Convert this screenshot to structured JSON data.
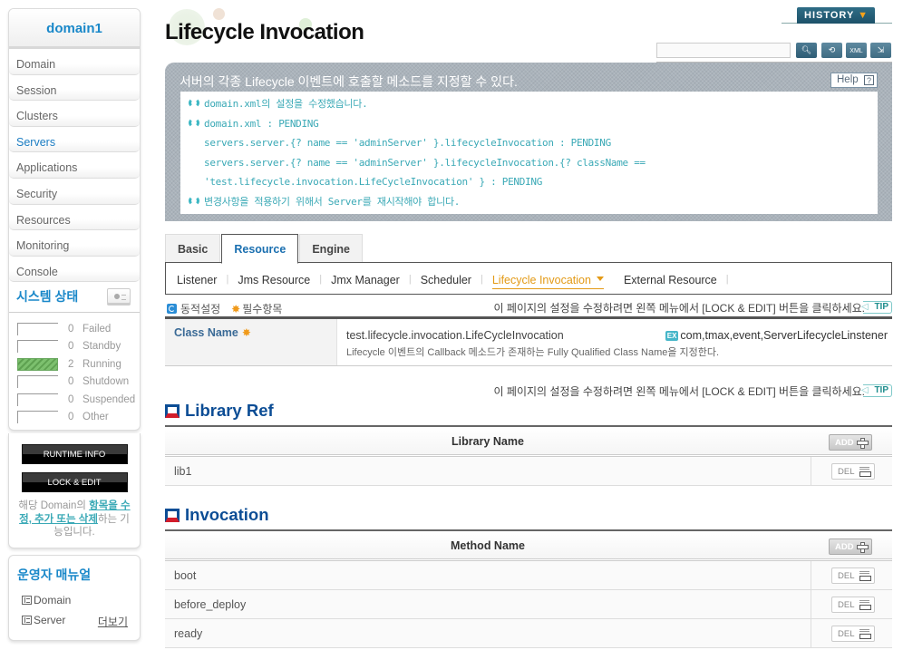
{
  "sidebar": {
    "domain_name": "domain1",
    "nav_items": [
      {
        "label": "Domain",
        "active": false
      },
      {
        "label": "Session",
        "active": false
      },
      {
        "label": "Clusters",
        "active": false
      },
      {
        "label": "Servers",
        "active": true
      },
      {
        "label": "Applications",
        "active": false
      },
      {
        "label": "Security",
        "active": false
      },
      {
        "label": "Resources",
        "active": false
      },
      {
        "label": "Monitoring",
        "active": false
      },
      {
        "label": "Console",
        "active": false
      }
    ],
    "system_status": {
      "title": "시스템 상태",
      "rows": [
        {
          "count": "0",
          "label": "Failed",
          "filled": false
        },
        {
          "count": "0",
          "label": "Standby",
          "filled": false
        },
        {
          "count": "2",
          "label": "Running",
          "filled": true
        },
        {
          "count": "0",
          "label": "Shutdown",
          "filled": false
        },
        {
          "count": "0",
          "label": "Suspended",
          "filled": false
        },
        {
          "count": "0",
          "label": "Other",
          "filled": false
        }
      ],
      "colors": {
        "running": "#7cc06e"
      }
    },
    "actions": {
      "runtime_info": "RUNTIME INFO",
      "lock_edit": "LOCK & EDIT",
      "desc_prefix": "해당 Domain의 ",
      "desc_link": "항목을 수정, 추가 또는 삭제",
      "desc_suffix": "하는 기능입니다."
    },
    "manual": {
      "title": "운영자 매뉴얼",
      "items": [
        "Domain",
        "Server"
      ],
      "more": "더보기"
    }
  },
  "header": {
    "page_title": "Lifecycle Invocation",
    "history_label": "HISTORY",
    "search_value": "",
    "tool_icons": [
      "search-icon",
      "refresh-icon",
      "xml-export-icon",
      "export-icon"
    ]
  },
  "notice": {
    "title": "서버의 각종 Lifecycle 이벤트에 호출할 메소드를 지정할 수 있다.",
    "help_label": "Help",
    "messages": [
      {
        "icon": true,
        "text": "domain.xml의 설정을 수정했습니다."
      },
      {
        "icon": true,
        "text": "domain.xml : PENDING"
      },
      {
        "icon": false,
        "text": "servers.server.{? name == 'adminServer' }.lifecycleInvocation : PENDING"
      },
      {
        "icon": false,
        "text": "servers.server.{? name == 'adminServer' }.lifecycleInvocation.{? className =="
      },
      {
        "icon": false,
        "text": "'test.lifecycle.invocation.LifeCycleInvocation' } : PENDING"
      },
      {
        "icon": true,
        "text": "변경사항을 적용하기 위해서 Server를 재시작해야 합니다."
      }
    ],
    "text_color": "#3aa9b6"
  },
  "tabs": [
    {
      "label": "Basic",
      "active": false
    },
    {
      "label": "Resource",
      "active": true
    },
    {
      "label": "Engine",
      "active": false
    }
  ],
  "subtabs": [
    {
      "label": "Listener",
      "active": false
    },
    {
      "label": "Jms Resource",
      "active": false
    },
    {
      "label": "Jmx Manager",
      "active": false
    },
    {
      "label": "Scheduler",
      "active": false
    },
    {
      "label": "Lifecycle Invocation",
      "active": true
    },
    {
      "label": "External Resource",
      "active": false
    }
  ],
  "legend": {
    "dynamic": "동적설정",
    "required": "필수항목",
    "tip_text": "이 페이지의 설정을 수정하려면 왼쪽 메뉴에서 [LOCK & EDIT] 버튼을 클릭하세요.",
    "tip_badge": "TIP"
  },
  "class_field": {
    "label": "Class Name",
    "value": "test.lifecycle.invocation.LifeCycleInvocation",
    "description": "Lifecycle 이벤트의 Callback 메소드가 존재하는 Fully Qualified Class Name을 지정한다.",
    "example_badge": "EX",
    "example": "com,tmax,event,ServerLifecycleLinstener"
  },
  "library_ref": {
    "title": "Library Ref",
    "column": "Library Name",
    "add_label": "ADD",
    "del_label": "DEL",
    "rows": [
      "lib1"
    ]
  },
  "invocation": {
    "title": "Invocation",
    "column": "Method Name",
    "add_label": "ADD",
    "del_label": "DEL",
    "rows": [
      "boot",
      "before_deploy",
      "ready"
    ]
  },
  "colors": {
    "accent_blue": "#1a88c9",
    "section_blue": "#0c4d95",
    "active_subtab": "#e39a16",
    "section_red": "#d21c2a"
  }
}
